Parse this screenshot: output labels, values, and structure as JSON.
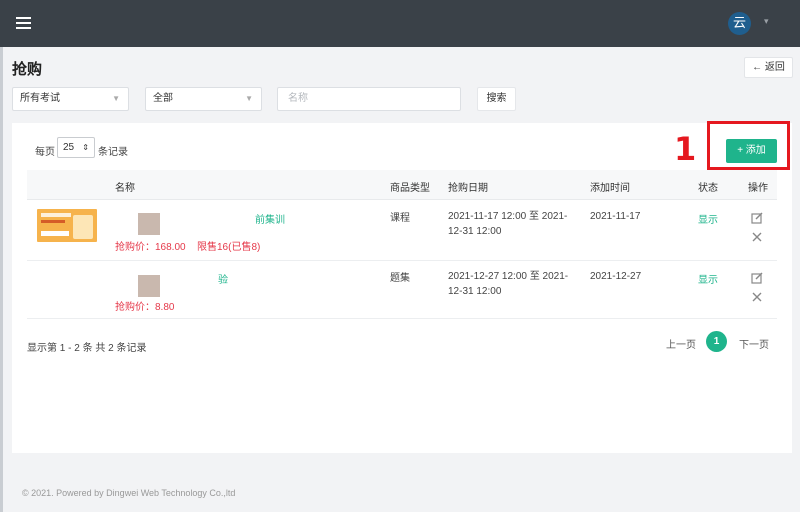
{
  "header": {
    "avatar_text": "云",
    "caret": "▾"
  },
  "page": {
    "title": "抢购",
    "back_label": "← 返回"
  },
  "filters": {
    "exam_select": "所有考试",
    "type_select": "全部",
    "name_placeholder": "名称",
    "search_label": "搜索"
  },
  "table_controls": {
    "per_page_prefix": "每页",
    "per_page_value": "25",
    "per_page_suffix": "条记录",
    "add_label": "+ 添加",
    "annotation": "1"
  },
  "table": {
    "headers": [
      "名称",
      "商品类型",
      "抢购日期",
      "添加时间",
      "状态",
      "操作"
    ],
    "rows": [
      {
        "name_visible": "前集训",
        "price": "抢购价：168.00",
        "limit": "限售16(已售8)",
        "type": "课程",
        "date_line1": "2021-11-17 12:00 至 2021-",
        "date_line2": "12-31 12:00",
        "added": "2021-11-17",
        "status": "显示"
      },
      {
        "name_visible": "验",
        "price": "抢购价：8.80",
        "limit": "",
        "type": "题集",
        "date_line1": "2021-12-27 12:00 至 2021-",
        "date_line2": "12-31 12:00",
        "added": "2021-12-27",
        "status": "显示"
      }
    ]
  },
  "pagination": {
    "summary": "显示第 1 - 2 条   共 2 条记录",
    "prev": "上一页",
    "current": "1",
    "next": "下一页"
  },
  "footer": {
    "copyright": "© 2021. Powered by Dingwei Web Technology Co.,ltd"
  },
  "colors": {
    "accent": "#1fb48c",
    "topbar": "#3a4148",
    "price": "#e5394a",
    "annotation": "#e5181f"
  }
}
